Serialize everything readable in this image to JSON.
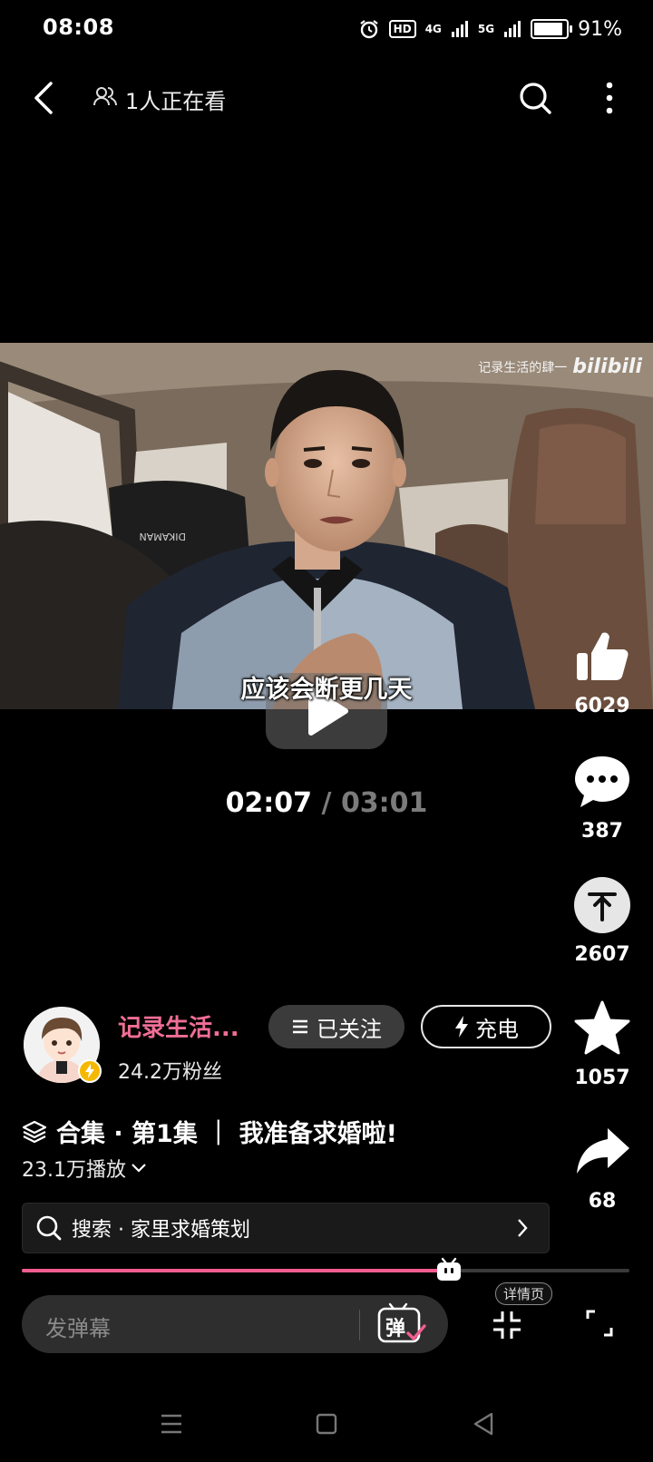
{
  "status_bar": {
    "time": "08:08",
    "hd_label": "HD",
    "net1": "4G",
    "net2": "5G",
    "battery": "91%",
    "battery_level": 0.91
  },
  "top_bar": {
    "watching": "1人正在看"
  },
  "video": {
    "subtitle": "应该会断更几天",
    "watermark_text": "记录生活的肆一",
    "watermark_logo": "bilibili",
    "headrest_text": "DIKAMAN",
    "current_time": "02:07",
    "separator": "/",
    "total_time": "03:01",
    "progress_fraction": 0.703
  },
  "actions": {
    "like_count": "6029",
    "comment_count": "387",
    "coin_count": "2607",
    "favorite_count": "1057",
    "share_count": "68"
  },
  "uploader": {
    "name": "记录生活...",
    "fans": "24.2万粉丝",
    "follow_label": "已关注",
    "charge_label": "充电"
  },
  "collection": {
    "title": "合集 · 第1集 ｜ 我准备求婚啦!",
    "plays": "23.1万播放"
  },
  "search": {
    "text": "搜索 · 家里求婚策划"
  },
  "bottom": {
    "danmu_placeholder": "发弹幕",
    "danmu_icon_label": "弹",
    "detail_tag": "详情页"
  },
  "colors": {
    "accent_pink": "#f25d8e",
    "name_pink": "#f06e95",
    "background": "#000000"
  }
}
